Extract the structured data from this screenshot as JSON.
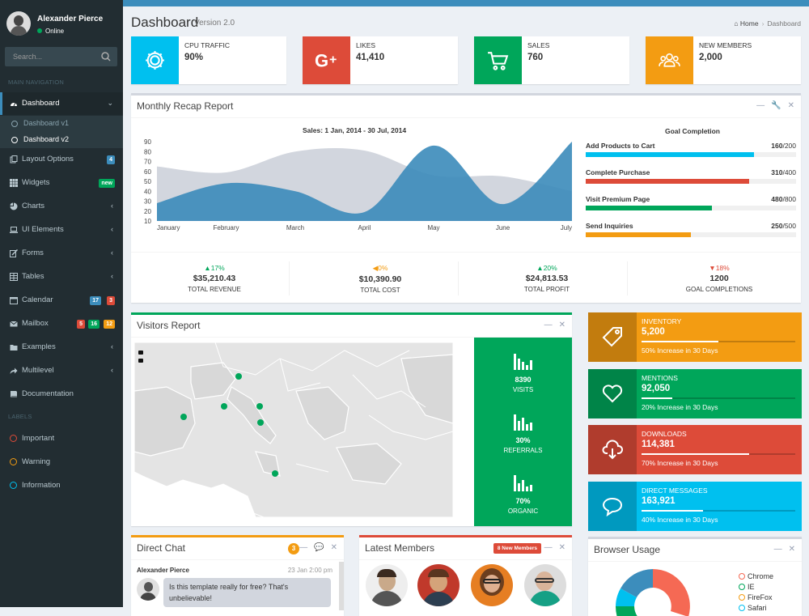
{
  "user": {
    "name": "Alexander Pierce",
    "status": "Online"
  },
  "search": {
    "placeholder": "Search..."
  },
  "nav_header": "MAIN NAVIGATION",
  "labels_header": "LABELS",
  "nav": {
    "dashboard": "Dashboard",
    "sub_v1": "Dashboard v1",
    "sub_v2": "Dashboard v2",
    "layout": "Layout Options",
    "layout_badge": "4",
    "widgets": "Widgets",
    "widgets_badge": "new",
    "charts": "Charts",
    "ui": "UI Elements",
    "forms": "Forms",
    "tables": "Tables",
    "calendar": "Calendar",
    "calendar_badges": [
      "17",
      "3"
    ],
    "mailbox": "Mailbox",
    "mailbox_badges": [
      "5",
      "16",
      "12"
    ],
    "examples": "Examples",
    "multilevel": "Multilevel",
    "documentation": "Documentation"
  },
  "labels": [
    "Important",
    "Warning",
    "Information"
  ],
  "colors": {
    "primary": "#3c8dbc",
    "aqua": "#00c0ef",
    "red": "#dd4b39",
    "green": "#00a65a",
    "yellow": "#f39c12",
    "sidebar": "#222d32"
  },
  "page": {
    "title": "Dashboard",
    "version": "Version 2.0",
    "breadcrumb_home": "Home",
    "breadcrumb_current": "Dashboard"
  },
  "info_boxes": [
    {
      "title": "CPU TRAFFIC",
      "value": "90%",
      "icon": "gear-icon",
      "color": "#00c0ef"
    },
    {
      "title": "LIKES",
      "value": "41,410",
      "icon": "google-plus-icon",
      "color": "#dd4b39"
    },
    {
      "title": "SALES",
      "value": "760",
      "icon": "shopping-cart-icon",
      "color": "#00a65a"
    },
    {
      "title": "NEW MEMBERS",
      "value": "2,000",
      "icon": "users-icon",
      "color": "#f39c12"
    }
  ],
  "monthly": {
    "title": "Monthly Recap Report",
    "tools": [
      "—",
      "🔧",
      "✕"
    ],
    "chart_title": "Sales: 1 Jan, 2014 - 30 Jul, 2014",
    "goal_title": "Goal Completion",
    "goals": [
      {
        "label": "Add Products to Cart",
        "value": "160",
        "total": "/200",
        "fraction": 0.8,
        "color": "#00c0ef"
      },
      {
        "label": "Complete Purchase",
        "value": "310",
        "total": "/400",
        "fraction": 0.775,
        "color": "#dd4b39"
      },
      {
        "label": "Visit Premium Page",
        "value": "480",
        "total": "/800",
        "fraction": 0.6,
        "color": "#00a65a"
      },
      {
        "label": "Send Inquiries",
        "value": "250",
        "total": "/500",
        "fraction": 0.5,
        "color": "#f39c12"
      }
    ],
    "stats": [
      {
        "pct": "▲17%",
        "value": "$35,210.43",
        "label": "TOTAL REVENUE",
        "color": "#00a65a"
      },
      {
        "pct": "◀0%",
        "value": "$10,390.90",
        "label": "TOTAL COST",
        "color": "#f39c12"
      },
      {
        "pct": "▲20%",
        "value": "$24,813.53",
        "label": "TOTAL PROFIT",
        "color": "#00a65a"
      },
      {
        "pct": "▼18%",
        "value": "1200",
        "label": "GOAL COMPLETIONS",
        "color": "#dd4b39"
      }
    ]
  },
  "chart_data": {
    "type": "area",
    "title": "Sales: 1 Jan, 2014 - 30 Jul, 2014",
    "categories": [
      "January",
      "February",
      "March",
      "April",
      "May",
      "June",
      "July"
    ],
    "y_ticks": [
      10,
      20,
      30,
      40,
      50,
      60,
      70,
      80,
      90
    ],
    "ylim": [
      10,
      90
    ],
    "series": [
      {
        "values": [
          65,
          59,
          80,
          81,
          56,
          55,
          40
        ],
        "color": "#d2d6de"
      },
      {
        "values": [
          28,
          48,
          40,
          19,
          86,
          27,
          90
        ],
        "color": "#3b8bba"
      }
    ]
  },
  "visitors": {
    "title": "Visitors Report",
    "tools": [
      "—",
      "✕"
    ],
    "stats": [
      {
        "value": "8390",
        "label": "VISITS"
      },
      {
        "value": "30%",
        "label": "REFERRALS"
      },
      {
        "value": "70%",
        "label": "ORGANIC"
      }
    ]
  },
  "tiles": [
    {
      "title": "INVENTORY",
      "value": "5,200",
      "desc": "50% Increase in 30 Days",
      "progress": 0.5,
      "color": "#f39c12",
      "icon": "tag-icon"
    },
    {
      "title": "MENTIONS",
      "value": "92,050",
      "desc": "20% Increase in 30 Days",
      "progress": 0.2,
      "color": "#00a65a",
      "icon": "heart-icon"
    },
    {
      "title": "DOWNLOADS",
      "value": "114,381",
      "desc": "70% Increase in 30 Days",
      "progress": 0.7,
      "color": "#dd4b39",
      "icon": "cloud-download-icon"
    },
    {
      "title": "DIRECT MESSAGES",
      "value": "163,921",
      "desc": "40% Increase in 30 Days",
      "progress": 0.4,
      "color": "#00c0ef",
      "icon": "chat-bubble-icon"
    }
  ],
  "chat": {
    "title": "Direct Chat",
    "badge": "3",
    "tools": [
      "—",
      "💬",
      "✕"
    ],
    "msg_name": "Alexander Pierce",
    "msg_time": "23 Jan 2:00 pm",
    "msg_text": "Is this template really for free? That's unbelievable!"
  },
  "members": {
    "title": "Latest Members",
    "badge": "8 New Members",
    "tools": [
      "—",
      "✕"
    ]
  },
  "browser": {
    "title": "Browser Usage",
    "tools": [
      "—",
      "✕"
    ],
    "legend": [
      {
        "name": "Chrome",
        "color": "#f56954"
      },
      {
        "name": "IE",
        "color": "#00a65a"
      },
      {
        "name": "FireFox",
        "color": "#f39c12"
      },
      {
        "name": "Safari",
        "color": "#00c0ef"
      }
    ]
  }
}
